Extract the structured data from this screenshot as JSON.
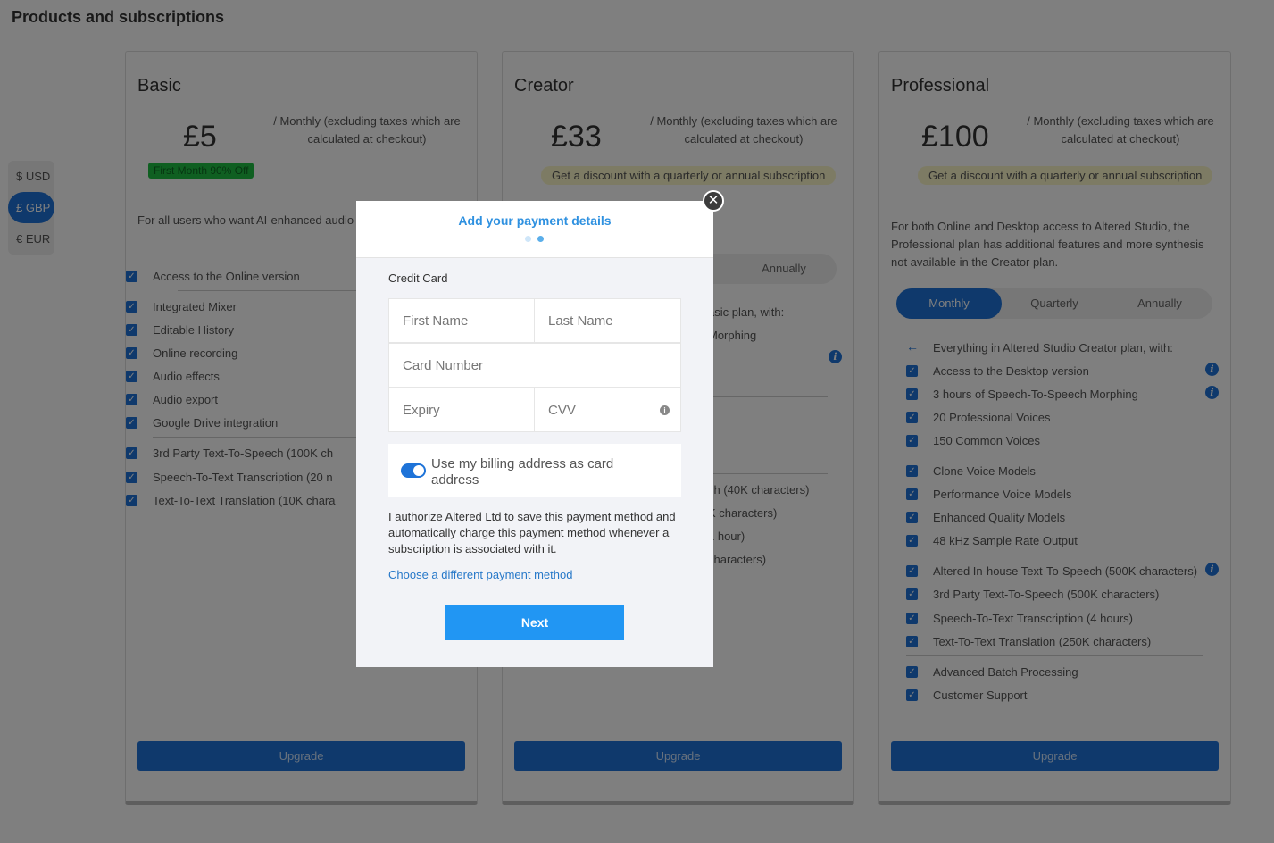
{
  "page": {
    "title": "Products and subscriptions"
  },
  "currency": {
    "options": [
      "$ USD",
      "£ GBP",
      "€ EUR"
    ],
    "selected": "£ GBP"
  },
  "colors": {
    "accent": "#1e73d8",
    "modal_title": "#2f91e0",
    "next_button": "#2196f3",
    "overlay": "rgba(0,0,0,0.5)"
  },
  "plans": [
    {
      "name": "Basic",
      "price": "£5",
      "price_note": "/ Monthly (excluding taxes which are calculated at checkout)",
      "badge": "First Month 90% Off",
      "description": "For all users who want AI-enhanced audio",
      "features": [
        "Access to the Online version",
        "Integrated Mixer",
        "Editable History",
        "Online recording",
        "Audio effects",
        "Audio export",
        "Google Drive integration",
        "3rd Party Text-To-Speech (100K ch",
        "Speech-To-Text Transcription (20 n",
        "Text-To-Text Translation (10K chara"
      ],
      "upgrade_label": "Upgrade"
    },
    {
      "name": "Creator",
      "price": "£33",
      "price_note": "/ Monthly (excluding taxes which are calculated at checkout)",
      "badge": "Get a discount with a quarterly or annual subscription",
      "period_visible": "Annually",
      "partial_lines": [
        "asic plan, with:",
        "Morphing",
        "ch (40K characters)",
        "K characters)",
        "1 hour)",
        "characters)"
      ],
      "upgrade_label": "Upgrade"
    },
    {
      "name": "Professional",
      "price": "£100",
      "price_note": "/ Monthly (excluding taxes which are calculated at checkout)",
      "badge": "Get a discount with a quarterly or annual subscription",
      "description": "For both Online and Desktop access to Altered Studio, the Professional plan has additional features and more synthesis not available in the Creator plan.",
      "periods": [
        "Monthly",
        "Quarterly",
        "Annually"
      ],
      "period_selected": "Monthly",
      "features_header": "Everything in Altered Studio Creator plan, with:",
      "features": [
        "Access to the Desktop version",
        "3 hours of Speech-To-Speech Morphing",
        "20 Professional Voices",
        "150 Common Voices",
        "Clone Voice Models",
        "Performance Voice Models",
        "Enhanced Quality Models",
        "48 kHz Sample Rate Output",
        "Altered In-house Text-To-Speech (500K characters)",
        "3rd Party Text-To-Speech (500K characters)",
        "Speech-To-Text Transcription (4 hours)",
        "Text-To-Text Translation (250K characters)",
        "Advanced Batch Processing",
        "Customer Support"
      ],
      "upgrade_label": "Upgrade"
    }
  ],
  "modal": {
    "title": "Add your payment details",
    "close_icon": "close-icon",
    "section_label": "Credit Card",
    "fields": {
      "first_name": "First Name",
      "last_name": "Last Name",
      "card_number": "Card Number",
      "expiry": "Expiry",
      "cvv": "CVV"
    },
    "billing_toggle_label": "Use my billing address as card address",
    "billing_toggle_on": true,
    "authorization_text": "I authorize Altered Ltd to save this payment method and automatically charge this payment method whenever a subscription is associated with it.",
    "alt_payment_link": "Choose a different payment method",
    "next_label": "Next"
  }
}
